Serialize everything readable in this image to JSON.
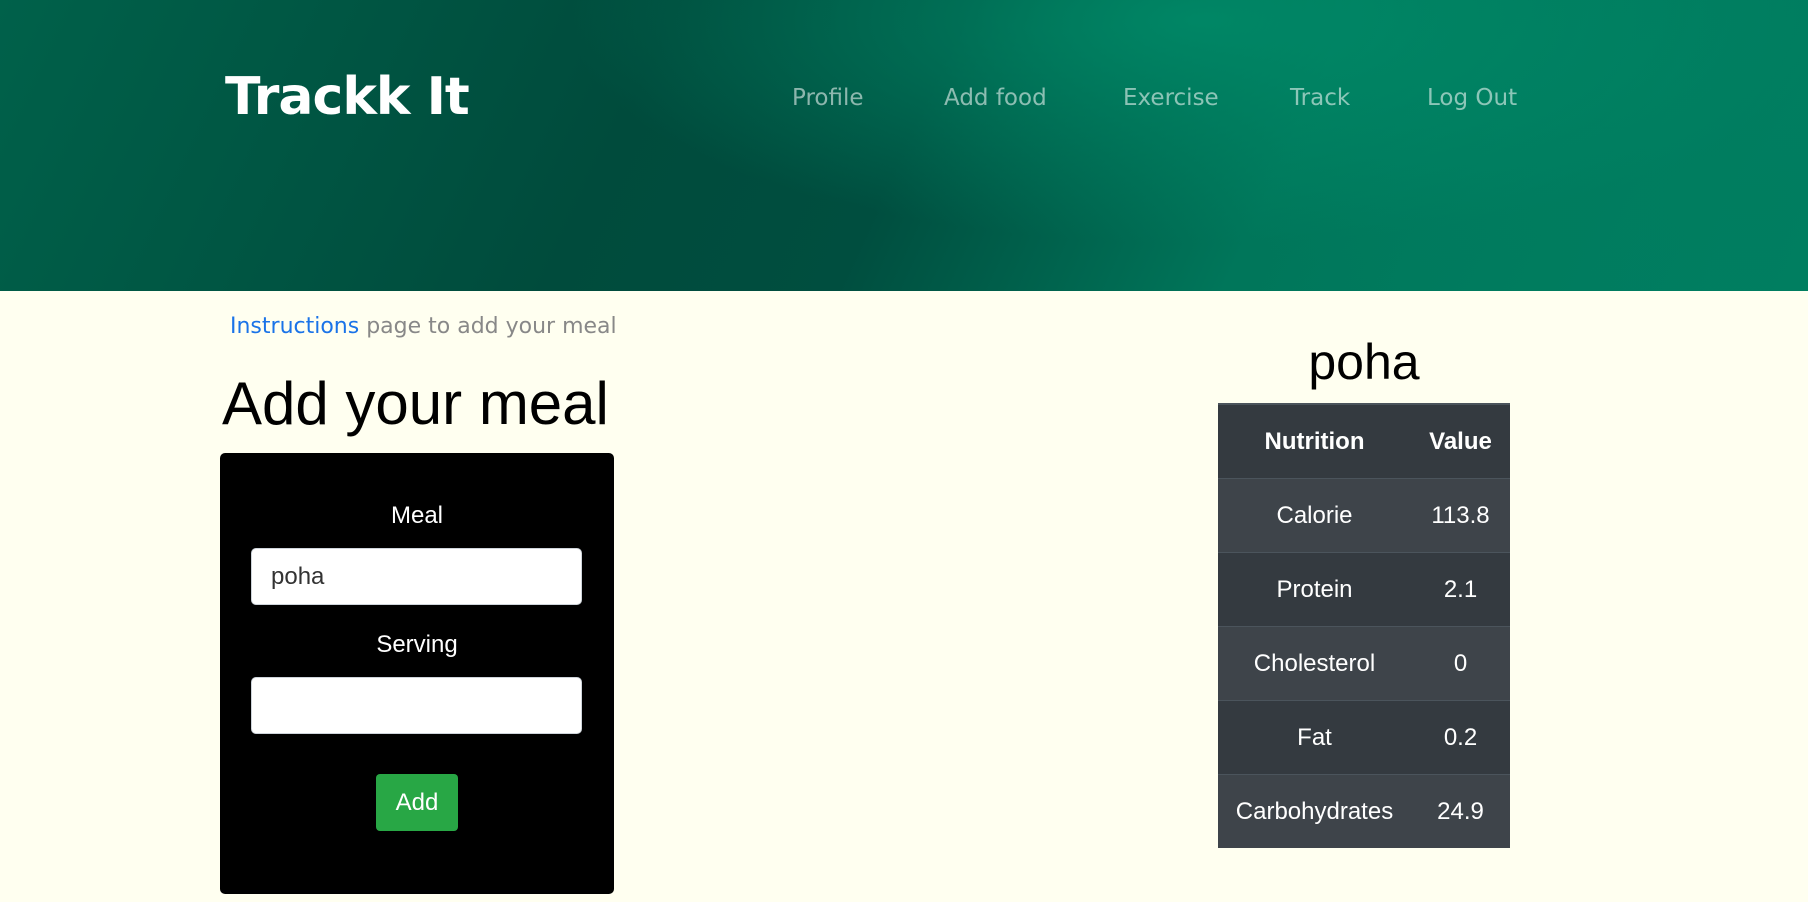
{
  "header": {
    "brand": "Trackk It",
    "nav": [
      {
        "label": "Profile"
      },
      {
        "label": "Add food"
      },
      {
        "label": "Exercise"
      },
      {
        "label": "Track"
      },
      {
        "label": "Log Out"
      }
    ]
  },
  "instructions": {
    "link_text": "Instructions",
    "rest_text": " page to add your meal"
  },
  "form": {
    "title": "Add your meal",
    "meal_label": "Meal",
    "meal_value": "poha",
    "serving_label": "Serving",
    "serving_value": "",
    "add_button": "Add"
  },
  "nutrition": {
    "food_name": "poha",
    "columns": [
      "Nutrition",
      "Value"
    ],
    "rows": [
      {
        "name": "Calorie",
        "value": "113.8"
      },
      {
        "name": "Protein",
        "value": "2.1"
      },
      {
        "name": "Cholesterol",
        "value": "0"
      },
      {
        "name": "Fat",
        "value": "0.2"
      },
      {
        "name": "Carbohydrates",
        "value": "24.9"
      }
    ]
  },
  "colors": {
    "header_dark": "#004b3c",
    "header_light": "#007f62",
    "page_bg": "#fffff0",
    "link": "#1a73e8",
    "add_button": "#28a745",
    "table_dark": "#343a40",
    "table_light": "#3e444a"
  }
}
